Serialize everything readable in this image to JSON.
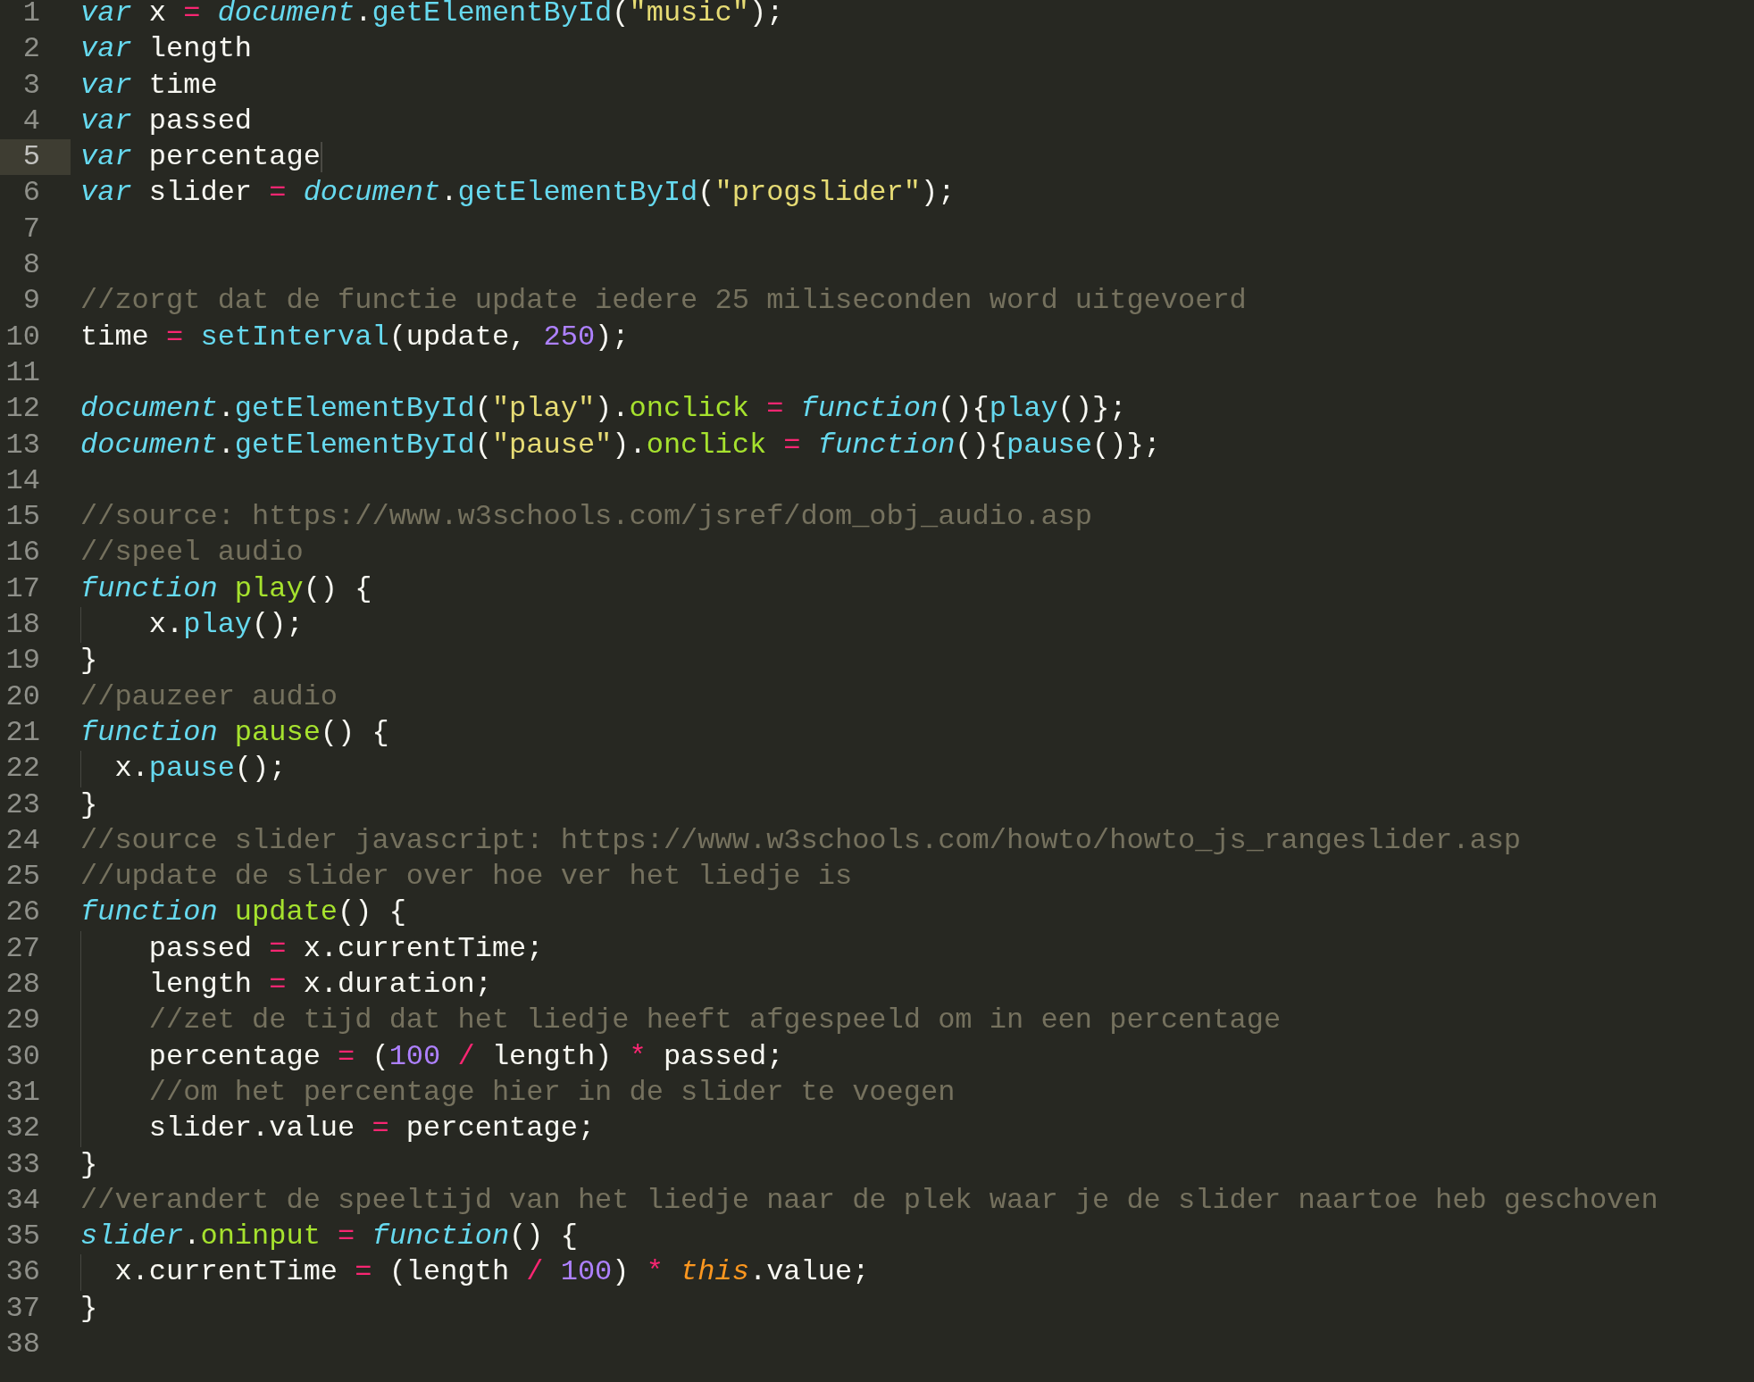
{
  "editor": {
    "lines": [
      {
        "number": "1",
        "current": false,
        "tokens": [
          {
            "kind": "keyword",
            "text": "var"
          },
          {
            "kind": "plain",
            "text": " x "
          },
          {
            "kind": "operator",
            "text": "= "
          },
          {
            "kind": "object",
            "text": "document"
          },
          {
            "kind": "plain",
            "text": "."
          },
          {
            "kind": "call",
            "text": "getElementById"
          },
          {
            "kind": "plain",
            "text": "("
          },
          {
            "kind": "string",
            "text": "\"music\""
          },
          {
            "kind": "plain",
            "text": ");"
          }
        ]
      },
      {
        "number": "2",
        "current": false,
        "tokens": [
          {
            "kind": "keyword",
            "text": "var"
          },
          {
            "kind": "plain",
            "text": " length"
          }
        ]
      },
      {
        "number": "3",
        "current": false,
        "tokens": [
          {
            "kind": "keyword",
            "text": "var"
          },
          {
            "kind": "plain",
            "text": " time"
          }
        ]
      },
      {
        "number": "4",
        "current": false,
        "tokens": [
          {
            "kind": "keyword",
            "text": "var"
          },
          {
            "kind": "plain",
            "text": " passed"
          }
        ]
      },
      {
        "number": "5",
        "current": true,
        "tokens": [
          {
            "kind": "keyword",
            "text": "var"
          },
          {
            "kind": "plain",
            "text": " percentage"
          }
        ]
      },
      {
        "number": "6",
        "current": false,
        "tokens": [
          {
            "kind": "keyword",
            "text": "var"
          },
          {
            "kind": "plain",
            "text": " slider "
          },
          {
            "kind": "operator",
            "text": "= "
          },
          {
            "kind": "object",
            "text": "document"
          },
          {
            "kind": "plain",
            "text": "."
          },
          {
            "kind": "call",
            "text": "getElementById"
          },
          {
            "kind": "plain",
            "text": "("
          },
          {
            "kind": "string",
            "text": "\"progslider\""
          },
          {
            "kind": "plain",
            "text": ");"
          }
        ]
      },
      {
        "number": "7",
        "current": false
      },
      {
        "number": "8",
        "current": false
      },
      {
        "number": "9",
        "current": false,
        "tokens": [
          {
            "kind": "comment",
            "text": "//zorgt dat de functie update iedere 25 miliseconden word uitgevoerd"
          }
        ]
      },
      {
        "number": "10",
        "current": false,
        "tokens": [
          {
            "kind": "plain",
            "text": "time "
          },
          {
            "kind": "operator",
            "text": "= "
          },
          {
            "kind": "call",
            "text": "setInterval"
          },
          {
            "kind": "plain",
            "text": "(update, "
          },
          {
            "kind": "number",
            "text": "250"
          },
          {
            "kind": "plain",
            "text": ");"
          }
        ]
      },
      {
        "number": "11",
        "current": false
      },
      {
        "number": "12",
        "current": false,
        "tokens": [
          {
            "kind": "object",
            "text": "document"
          },
          {
            "kind": "plain",
            "text": "."
          },
          {
            "kind": "call",
            "text": "getElementById"
          },
          {
            "kind": "plain",
            "text": "("
          },
          {
            "kind": "string",
            "text": "\"play\""
          },
          {
            "kind": "plain",
            "text": ")."
          },
          {
            "kind": "property",
            "text": "onclick"
          },
          {
            "kind": "operator",
            "text": " = "
          },
          {
            "kind": "keyword",
            "text": "function"
          },
          {
            "kind": "plain",
            "text": "(){"
          },
          {
            "kind": "call",
            "text": "play"
          },
          {
            "kind": "plain",
            "text": "()};"
          }
        ]
      },
      {
        "number": "13",
        "current": false,
        "tokens": [
          {
            "kind": "object",
            "text": "document"
          },
          {
            "kind": "plain",
            "text": "."
          },
          {
            "kind": "call",
            "text": "getElementById"
          },
          {
            "kind": "plain",
            "text": "("
          },
          {
            "kind": "string",
            "text": "\"pause\""
          },
          {
            "kind": "plain",
            "text": ")."
          },
          {
            "kind": "property",
            "text": "onclick"
          },
          {
            "kind": "operator",
            "text": " = "
          },
          {
            "kind": "keyword",
            "text": "function"
          },
          {
            "kind": "plain",
            "text": "(){"
          },
          {
            "kind": "call",
            "text": "pause"
          },
          {
            "kind": "plain",
            "text": "()};"
          }
        ]
      },
      {
        "number": "14",
        "current": false
      },
      {
        "number": "15",
        "current": false,
        "tokens": [
          {
            "kind": "comment",
            "text": "//source: https://www.w3schools.com/jsref/dom_obj_audio.asp"
          }
        ]
      },
      {
        "number": "16",
        "current": false,
        "tokens": [
          {
            "kind": "comment",
            "text": "//speel audio"
          }
        ]
      },
      {
        "number": "17",
        "current": false,
        "tokens": [
          {
            "kind": "keyword",
            "text": "function"
          },
          {
            "kind": "definition",
            "text": " play"
          },
          {
            "kind": "plain",
            "text": "() {"
          }
        ]
      },
      {
        "number": "18",
        "current": false,
        "tokens": [
          {
            "kind": "plain",
            "text": "    x."
          },
          {
            "kind": "call",
            "text": "play"
          },
          {
            "kind": "plain",
            "text": "();"
          }
        ]
      },
      {
        "number": "19",
        "current": false,
        "tokens": [
          {
            "kind": "plain",
            "text": "}"
          }
        ]
      },
      {
        "number": "20",
        "current": false,
        "tokens": [
          {
            "kind": "comment",
            "text": "//pauzeer audio"
          }
        ]
      },
      {
        "number": "21",
        "current": false,
        "tokens": [
          {
            "kind": "keyword",
            "text": "function"
          },
          {
            "kind": "definition",
            "text": " pause"
          },
          {
            "kind": "plain",
            "text": "() {"
          }
        ]
      },
      {
        "number": "22",
        "current": false,
        "tokens": [
          {
            "kind": "plain",
            "text": "  x."
          },
          {
            "kind": "call",
            "text": "pause"
          },
          {
            "kind": "plain",
            "text": "();"
          }
        ]
      },
      {
        "number": "23",
        "current": false,
        "tokens": [
          {
            "kind": "plain",
            "text": "}"
          }
        ]
      },
      {
        "number": "24",
        "current": false,
        "tokens": [
          {
            "kind": "comment",
            "text": "//source slider javascript: https://www.w3schools.com/howto/howto_js_rangeslider.asp"
          }
        ]
      },
      {
        "number": "25",
        "current": false,
        "tokens": [
          {
            "kind": "comment",
            "text": "//update de slider over hoe ver het liedje is"
          }
        ]
      },
      {
        "number": "26",
        "current": false,
        "tokens": [
          {
            "kind": "keyword",
            "text": "function"
          },
          {
            "kind": "definition",
            "text": " update"
          },
          {
            "kind": "plain",
            "text": "() {"
          }
        ]
      },
      {
        "number": "27",
        "current": false,
        "tokens": [
          {
            "kind": "plain",
            "text": "    passed "
          },
          {
            "kind": "operator",
            "text": "="
          },
          {
            "kind": "plain",
            "text": " x.currentTime;"
          }
        ]
      },
      {
        "number": "28",
        "current": false,
        "tokens": [
          {
            "kind": "plain",
            "text": "    length "
          },
          {
            "kind": "operator",
            "text": "="
          },
          {
            "kind": "plain",
            "text": " x.duration;"
          }
        ]
      },
      {
        "number": "29",
        "current": false,
        "tokens": [
          {
            "kind": "comment",
            "text": "    //zet de tijd dat het liedje heeft afgespeeld om in een percentage"
          }
        ]
      },
      {
        "number": "30",
        "current": false,
        "tokens": [
          {
            "kind": "plain",
            "text": "    percentage "
          },
          {
            "kind": "operator",
            "text": "="
          },
          {
            "kind": "plain",
            "text": " ("
          },
          {
            "kind": "number",
            "text": "100"
          },
          {
            "kind": "operator",
            "text": " / "
          },
          {
            "kind": "plain",
            "text": "length) "
          },
          {
            "kind": "operator",
            "text": "*"
          },
          {
            "kind": "plain",
            "text": " passed;"
          }
        ]
      },
      {
        "number": "31",
        "current": false,
        "tokens": [
          {
            "kind": "comment",
            "text": "    //om het percentage hier in de slider te voegen"
          }
        ]
      },
      {
        "number": "32",
        "current": false,
        "tokens": [
          {
            "kind": "plain",
            "text": "    slider.value "
          },
          {
            "kind": "operator",
            "text": "="
          },
          {
            "kind": "plain",
            "text": " percentage;"
          }
        ]
      },
      {
        "number": "33",
        "current": false,
        "tokens": [
          {
            "kind": "plain",
            "text": "}"
          }
        ]
      },
      {
        "number": "34",
        "current": false,
        "tokens": [
          {
            "kind": "comment",
            "text": "//verandert de speeltijd van het liedje naar de plek waar je de slider naartoe heb geschoven"
          }
        ]
      },
      {
        "number": "35",
        "current": false,
        "tokens": [
          {
            "kind": "object",
            "text": "slider"
          },
          {
            "kind": "plain",
            "text": "."
          },
          {
            "kind": "property",
            "text": "oninput"
          },
          {
            "kind": "operator",
            "text": " = "
          },
          {
            "kind": "keyword",
            "text": "function"
          },
          {
            "kind": "plain",
            "text": "() {"
          }
        ]
      },
      {
        "number": "36",
        "current": false,
        "tokens": [
          {
            "kind": "plain",
            "text": "  x.currentTime "
          },
          {
            "kind": "operator",
            "text": "="
          },
          {
            "kind": "plain",
            "text": " (length "
          },
          {
            "kind": "operator",
            "text": "/ "
          },
          {
            "kind": "number",
            "text": "100"
          },
          {
            "kind": "plain",
            "text": ") "
          },
          {
            "kind": "operator",
            "text": "* "
          },
          {
            "kind": "this",
            "text": "this"
          },
          {
            "kind": "plain",
            "text": ".value;"
          }
        ]
      },
      {
        "number": "37",
        "current": false,
        "tokens": [
          {
            "kind": "plain",
            "text": "}"
          }
        ]
      },
      {
        "number": "38",
        "current": false
      }
    ]
  }
}
